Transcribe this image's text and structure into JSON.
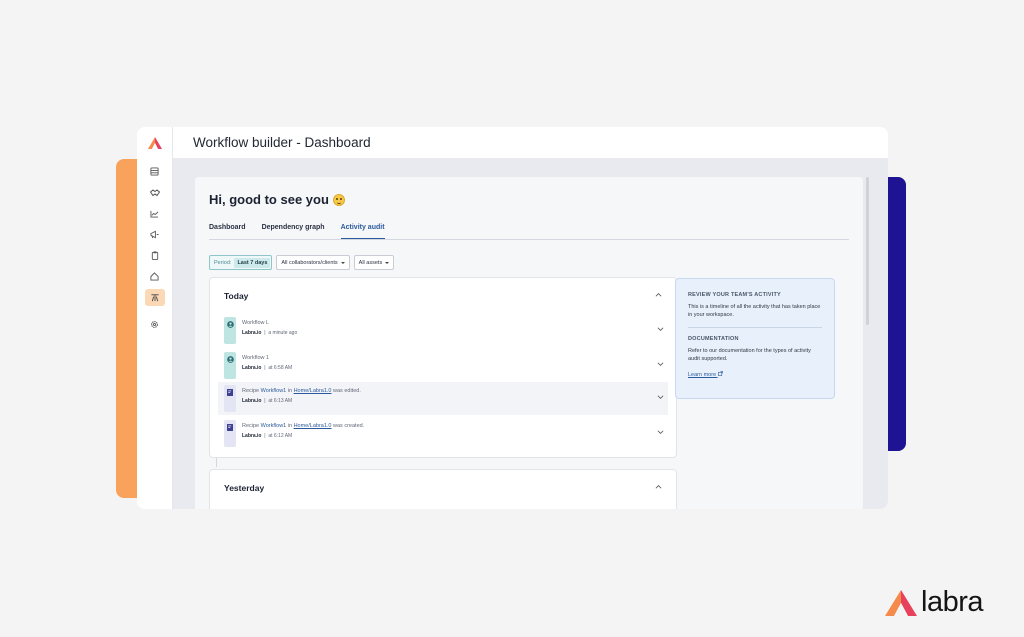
{
  "window": {
    "title": "Workflow builder - Dashboard"
  },
  "sidebar": {
    "items": [
      {
        "icon": "database-icon"
      },
      {
        "icon": "handshake-icon"
      },
      {
        "icon": "chart-icon"
      },
      {
        "icon": "megaphone-icon"
      },
      {
        "icon": "clipboard-icon"
      },
      {
        "icon": "home-icon"
      },
      {
        "icon": "workflow-icon",
        "active": true
      },
      {
        "icon": "gear-icon"
      }
    ]
  },
  "main": {
    "greeting": "Hi, good to see you",
    "tabs": [
      "Dashboard",
      "Dependency graph",
      "Activity audit"
    ],
    "active_tab": "Activity audit",
    "filters": {
      "period_label": "Period:",
      "period_value": "Last 7 days",
      "collaborators": "All collaborators/clients",
      "assets": "All assets"
    },
    "sections": [
      {
        "title": "Today",
        "events": [
          {
            "name": "Workflow L",
            "org": "Labra.io",
            "time": "a minute ago"
          },
          {
            "name": "Workflow 1",
            "org": "Labra.io",
            "time": "at 6:58 AM"
          },
          {
            "prefix": "Recipe",
            "workflow": "Workflow1",
            "in": "in",
            "link": "Home/Labra1.0",
            "action": "was edited.",
            "org": "Labra.io",
            "time": "at 6:13 AM"
          },
          {
            "prefix": "Recipe",
            "workflow": "Workflow1",
            "in": "in",
            "link": "Home/Labra1.0",
            "action": "was created.",
            "org": "Labra.io",
            "time": "at 6:12 AM"
          }
        ]
      },
      {
        "title": "Yesterday"
      }
    ],
    "info": {
      "heading": "REVIEW YOUR TEAM'S ACTIVITY",
      "text": "This is a timeline of all the activity that has taken place in your workspace.",
      "doc_heading": "DOCUMENTATION",
      "doc_text": "Refer to our documentation for the types of activity audit supported.",
      "link": "Learn more"
    }
  },
  "brand": {
    "name": "labra",
    "colors": {
      "orange": "#f8a25b",
      "navy": "#1d1393",
      "accent": "#2b5a9c"
    }
  }
}
